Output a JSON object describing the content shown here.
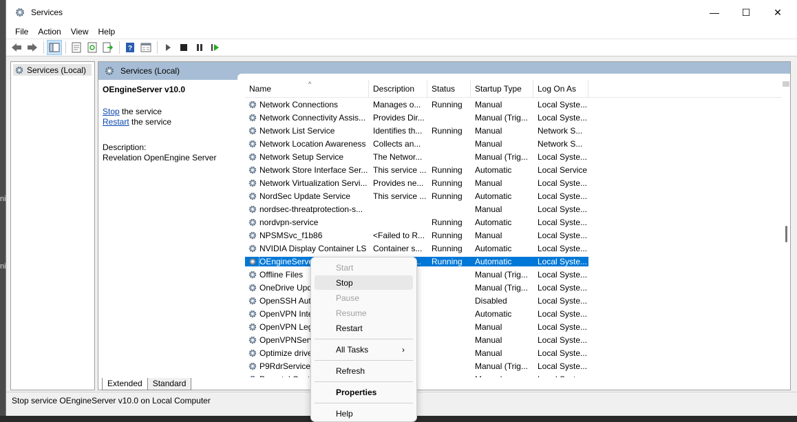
{
  "window": {
    "title": "Services",
    "controls": {
      "minimize": "—",
      "maximize": "☐",
      "close": "✕"
    }
  },
  "menu": [
    "File",
    "Action",
    "View",
    "Help"
  ],
  "toolbar": [
    "back-icon",
    "forward-icon",
    "show-tree-icon",
    "properties-icon",
    "refresh-icon",
    "export-icon",
    "help-icon",
    "console-icon",
    "start-icon",
    "stop-icon",
    "pause-icon",
    "restart-icon"
  ],
  "tree": {
    "root": "Services (Local)"
  },
  "pane": {
    "header": "Services (Local)"
  },
  "detail": {
    "service_name": "OEngineServer v10.0",
    "stop_link": "Stop",
    "stop_suffix": " the service",
    "restart_link": "Restart",
    "restart_suffix": " the service",
    "description_label": "Description:",
    "description": "Revelation OpenEngine Server"
  },
  "columns": [
    "Name",
    "Description",
    "Status",
    "Startup Type",
    "Log On As"
  ],
  "rows": [
    [
      "Network Connections",
      "Manages o...",
      "Running",
      "Manual",
      "Local Syste..."
    ],
    [
      "Network Connectivity Assis...",
      "Provides Dir...",
      "",
      "Manual (Trig...",
      "Local Syste..."
    ],
    [
      "Network List Service",
      "Identifies th...",
      "Running",
      "Manual",
      "Network S..."
    ],
    [
      "Network Location Awareness",
      "Collects an...",
      "",
      "Manual",
      "Network S..."
    ],
    [
      "Network Setup Service",
      "The Networ...",
      "",
      "Manual (Trig...",
      "Local Syste..."
    ],
    [
      "Network Store Interface Ser...",
      "This service ...",
      "Running",
      "Automatic",
      "Local Service"
    ],
    [
      "Network Virtualization Servi...",
      "Provides ne...",
      "Running",
      "Manual",
      "Local Syste..."
    ],
    [
      "NordSec Update Service",
      "This service ...",
      "Running",
      "Automatic",
      "Local Syste..."
    ],
    [
      "nordsec-threatprotection-s...",
      "",
      "",
      "Manual",
      "Local Syste..."
    ],
    [
      "nordvpn-service",
      "",
      "Running",
      "Automatic",
      "Local Syste..."
    ],
    [
      "NPSMSvc_f1b86",
      "<Failed to R...",
      "Running",
      "Manual",
      "Local Syste..."
    ],
    [
      "NVIDIA Display Container LS",
      "Container s...",
      "Running",
      "Automatic",
      "Local Syste..."
    ],
    [
      "OEngineServer v10.0",
      "Revelation ...",
      "Running",
      "Automatic",
      "Local Syste..."
    ],
    [
      "Offline Files",
      "",
      "",
      "Manual (Trig...",
      "Local Syste..."
    ],
    [
      "OneDrive Updater Service",
      "",
      "",
      "Manual (Trig...",
      "Local Syste..."
    ],
    [
      "OpenSSH Authentication Agent",
      "",
      "",
      "Disabled",
      "Local Syste..."
    ],
    [
      "OpenVPN Interactive Service",
      "",
      "",
      "Automatic",
      "Local Syste..."
    ],
    [
      "OpenVPN Legacy Service",
      "",
      "",
      "Manual",
      "Local Syste..."
    ],
    [
      "OpenVPNService",
      "",
      "",
      "Manual",
      "Local Syste..."
    ],
    [
      "Optimize drives",
      "",
      "",
      "Manual",
      "Local Syste..."
    ],
    [
      "P9RdrService_f1b86",
      "",
      "",
      "Manual (Trig...",
      "Local Syste..."
    ],
    [
      "Parental Controls",
      "",
      "",
      "Manual",
      "Local Syste..."
    ]
  ],
  "selected_row": 12,
  "tabs": [
    "Extended",
    "Standard"
  ],
  "status": "Stop service OEngineServer v10.0 on Local Computer",
  "context_menu": {
    "start": "Start",
    "stop": "Stop",
    "pause": "Pause",
    "resume": "Resume",
    "restart": "Restart",
    "all_tasks": "All Tasks",
    "all_tasks_arrow": "›",
    "refresh": "Refresh",
    "properties": "Properties",
    "help": "Help"
  },
  "background": {
    "side_text_1": "ni",
    "side_text_2": "ni"
  },
  "colors": {
    "selection": "#0078d7",
    "header": "#a7bdd5",
    "link": "#0645ad"
  }
}
